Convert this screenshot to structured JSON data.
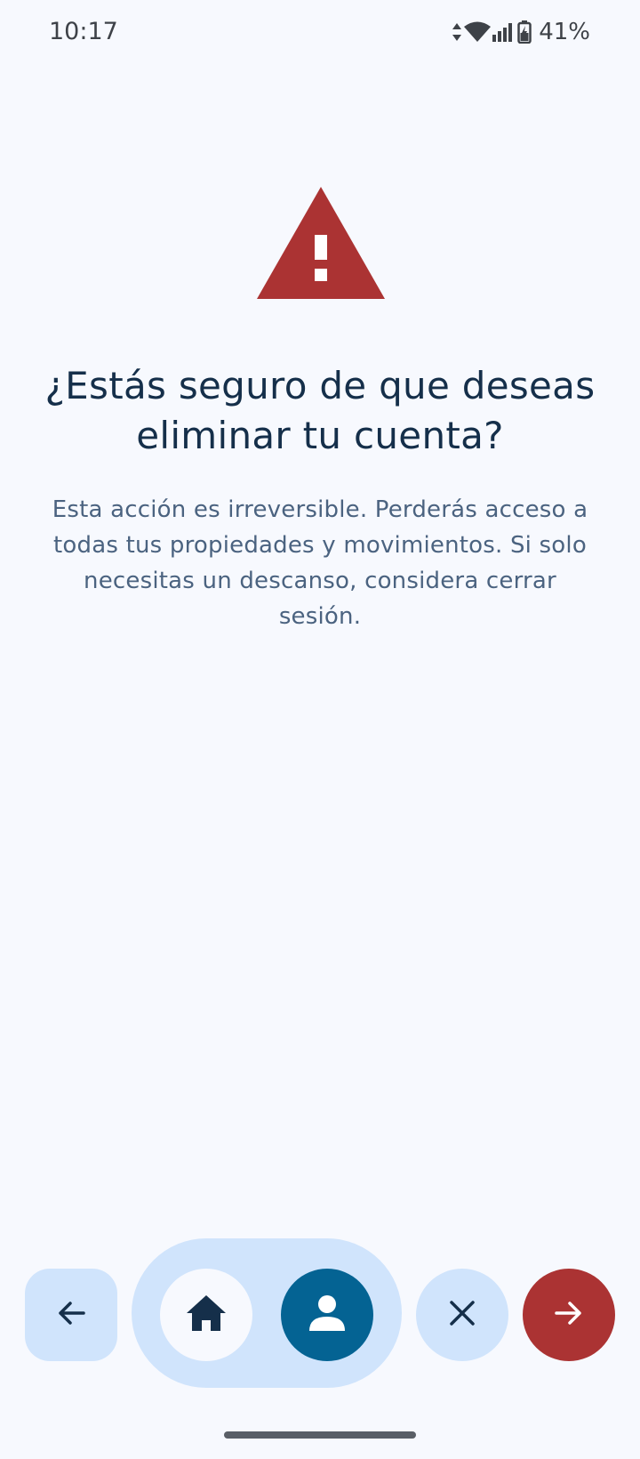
{
  "status_bar": {
    "time": "10:17",
    "battery": "41%",
    "icons": [
      "data-arrows-icon",
      "wifi-icon",
      "signal-icon",
      "battery-charging-icon"
    ]
  },
  "dialog": {
    "icon": "warning-triangle-icon",
    "title": "¿Estás seguro de que deseas eliminar tu cuenta?",
    "description": "Esta acción es irreversible. Perderás acceso a todas tus propiedades y movimientos. Si solo necesitas un descanso, considera cerrar sesión."
  },
  "toolbar": {
    "buttons": [
      {
        "name": "back-button",
        "icon": "arrow-left-icon"
      },
      {
        "name": "home-button",
        "icon": "home-icon"
      },
      {
        "name": "profile-button",
        "icon": "person-icon"
      },
      {
        "name": "close-button",
        "icon": "close-icon"
      },
      {
        "name": "next-button",
        "icon": "arrow-right-icon"
      }
    ]
  },
  "colors": {
    "background": "#f7f9fe",
    "warning": "#ab3333",
    "title": "#152f4a",
    "description": "#4b6380",
    "button_tonal": "#d0e4fc",
    "button_primary": "#046393",
    "button_danger": "#ab3333",
    "icon_dark": "#152f4a"
  }
}
